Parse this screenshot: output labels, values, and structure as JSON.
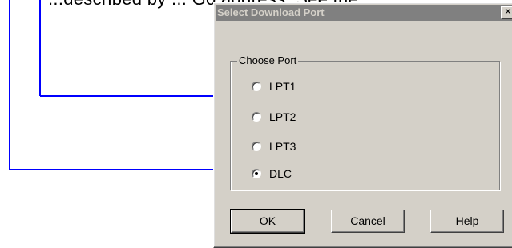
{
  "doc": {
    "top_text": "...described by ... Go address. See the"
  },
  "dialog": {
    "title": "Select Download Port",
    "close_symbol": "✕",
    "group_label": "Choose Port",
    "ports": [
      {
        "label": "LPT1",
        "selected": false
      },
      {
        "label": "LPT2",
        "selected": false
      },
      {
        "label": "LPT3",
        "selected": false
      },
      {
        "label": "DLC",
        "selected": true
      }
    ],
    "buttons": {
      "ok": "OK",
      "cancel": "Cancel",
      "help": "Help"
    }
  },
  "colors": {
    "callout": "#0000ff",
    "titlebar_inactive": "#808080",
    "face": "#d4d0c8"
  }
}
